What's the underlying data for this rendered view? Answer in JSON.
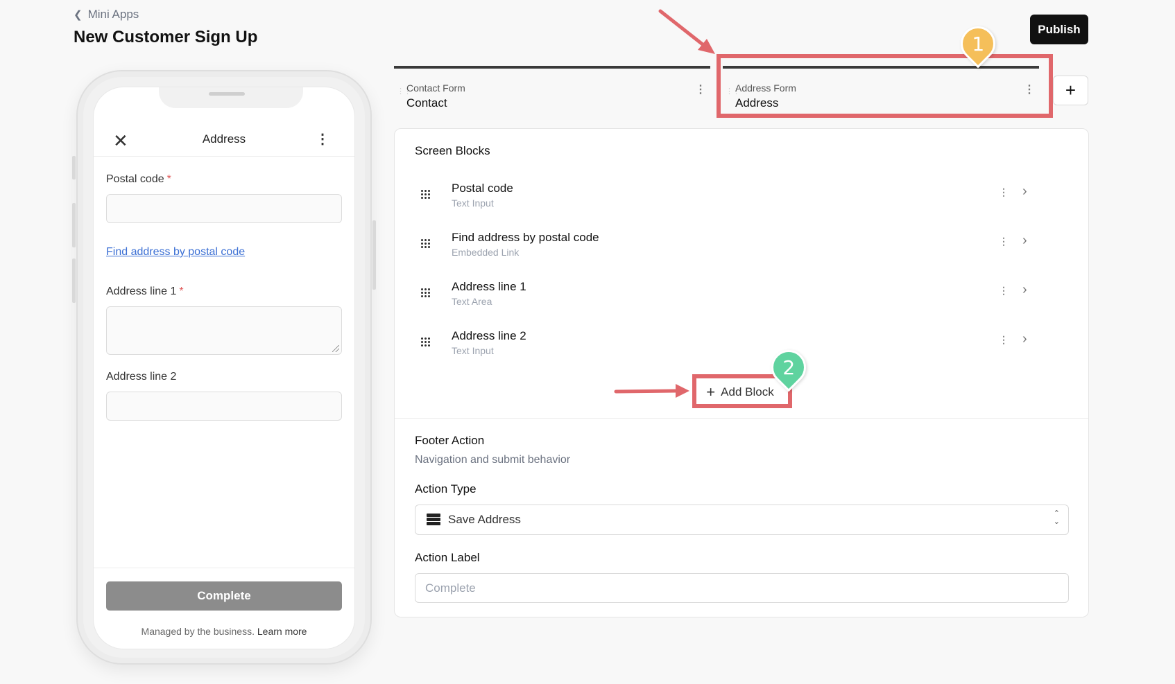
{
  "header": {
    "back_label": "Mini Apps",
    "title": "New Customer Sign Up",
    "publish_label": "Publish"
  },
  "phone": {
    "screen_title": "Address",
    "fields": [
      {
        "label": "Postal code",
        "required": true
      },
      {
        "label": "Address line 1",
        "required": true
      },
      {
        "label": "Address line 2",
        "required": false
      }
    ],
    "required_marker": "*",
    "link_text": "Find address by postal code",
    "complete_label": "Complete",
    "managed_text": "Managed by the business.",
    "learn_more": "Learn more"
  },
  "tabs": [
    {
      "sub": "Contact Form",
      "main": "Contact"
    },
    {
      "sub": "Address Form",
      "main": "Address"
    }
  ],
  "add_tab_label": "+",
  "screen_blocks": {
    "title": "Screen Blocks",
    "items": [
      {
        "name": "Postal code",
        "type": "Text Input"
      },
      {
        "name": "Find address by postal code",
        "type": "Embedded Link"
      },
      {
        "name": "Address line 1",
        "type": "Text Area"
      },
      {
        "name": "Address line 2",
        "type": "Text Input"
      }
    ],
    "add_block_label": "Add Block"
  },
  "footer_action": {
    "title": "Footer Action",
    "description": "Navigation and submit behavior",
    "action_type_label": "Action Type",
    "action_type_value": "Save Address",
    "action_label_label": "Action Label",
    "action_label_placeholder": "Complete"
  },
  "annotations": {
    "badge_1": "1",
    "badge_2": "2",
    "highlight_color": "#e0676b",
    "badge_1_color": "#f5bf5a",
    "badge_2_color": "#5fd39f"
  },
  "icons": {
    "back": "chevron-left-icon",
    "close": "close-icon",
    "kebab": "kebab-menu-icon",
    "grip": "drag-handle-icon",
    "chevron": "chevron-right-icon",
    "plus": "plus-icon",
    "server": "server-icon",
    "updown": "chevron-up-down-icon"
  }
}
